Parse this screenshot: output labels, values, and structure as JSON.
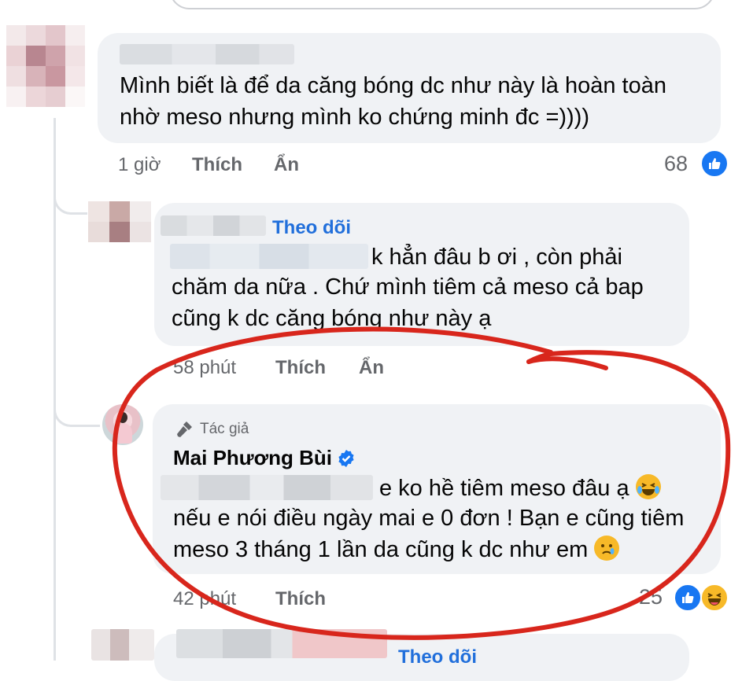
{
  "comments": [
    {
      "text_lines": [
        "Mình biết là để da căng bóng dc như này là hoàn toàn",
        "nhờ meso nhưng mình ko chứng minh đc =))))"
      ],
      "time": "1 giờ",
      "like_label": "Thích",
      "hide_label": "Ẩn",
      "reaction_count": "68",
      "reaction_icon": "like-icon"
    },
    {
      "follow_label": "Theo dõi",
      "text_lines": [
        "k hẳn đâu b ơi , còn phải",
        "chăm da nữa . Chứ mình tiêm cả meso cả bap",
        "cũng k dc căng bóng như này ạ"
      ],
      "time": "58 phút",
      "like_label": "Thích",
      "hide_label": "Ẩn"
    },
    {
      "author_badge": "Tác giả",
      "author_badge_icon": "microphone-icon",
      "author_name": "Mai Phương Bùi",
      "verified_icon": "verified-badge-icon",
      "text_lines": [
        "e ko hề tiêm meso đâu ạ",
        "nếu e nói điều ngày mai e 0 đơn ! Bạn e cũng tiêm",
        "meso 3 tháng 1 lần da cũng k dc như em"
      ],
      "emojis": [
        "laughing-tears-emoji",
        "crying-face-emoji"
      ],
      "time": "42 phút",
      "like_label": "Thích",
      "reaction_count": "25",
      "reaction_icons": [
        "like-icon",
        "haha-icon"
      ]
    },
    {
      "follow_label": "Theo dõi"
    }
  ],
  "colors": {
    "bubble": "#f0f2f5",
    "meta_text": "#65676b",
    "follow_link": "#216fdb",
    "like_blue": "#1877f2",
    "annotation_red": "#d8261c"
  }
}
